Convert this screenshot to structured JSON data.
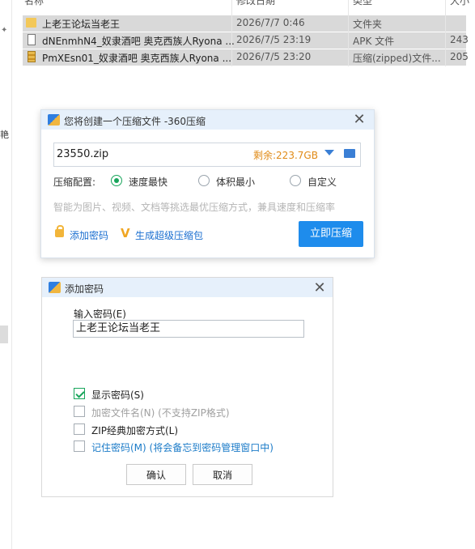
{
  "explorer": {
    "columns": [
      "名称",
      "修改日期",
      "类型",
      "大小"
    ],
    "files": [
      {
        "name": "上老王论坛当老王",
        "date": "2026/7/7 0:46",
        "type": "文件夹",
        "size": "",
        "icon": "folder-icon"
      },
      {
        "name": "dNEnmhN4_奴隶酒吧 奥克西族人Ryona ...",
        "date": "2026/7/5 23:19",
        "type": "APK 文件",
        "size": "243",
        "icon": "apk-file-icon"
      },
      {
        "name": "PmXEsn01_奴隶酒吧 奥克西族人Ryona ...",
        "date": "2026/7/5 23:20",
        "type": "压缩(zipped)文件...",
        "size": "205",
        "icon": "zip-file-icon"
      }
    ],
    "nav_fragment": "艳"
  },
  "compress_dialog": {
    "title": "您将创建一个压缩文件 -360压缩",
    "filename": "23550.zip",
    "free_space": "剩余:223.7GB",
    "config_label": "压缩配置:",
    "options": [
      {
        "label": "速度最快",
        "selected": true
      },
      {
        "label": "体积最小",
        "selected": false
      },
      {
        "label": "自定义",
        "selected": false
      }
    ],
    "hint": "智能为图片、视频、文档等挑选最优压缩方式，兼具速度和压缩率",
    "add_password": "添加密码",
    "super_package": "生成超级压缩包",
    "compress_now": "立即压缩"
  },
  "password_dialog": {
    "title": "添加密码",
    "input_label": "输入密码(E)",
    "password_value": "上老王论坛当老王",
    "checkboxes": [
      {
        "label": "显示密码(S)",
        "checked": true,
        "color": "#222222"
      },
      {
        "label": "加密文件名(N) (不支持ZIP格式)",
        "checked": false,
        "color": "#a0a0a0"
      },
      {
        "label": "ZIP经典加密方式(L)",
        "checked": false,
        "color": "#222222"
      },
      {
        "label": "记住密码(M) (将会备忘到密码管理窗口中)",
        "checked": false,
        "color": "#1b7bc8"
      }
    ],
    "ok": "确认",
    "cancel": "取消"
  },
  "colors": {
    "accent_blue": "#1e8cec",
    "free_space_orange": "#e08a16",
    "check_green": "#18a55b",
    "link_blue": "#1b6fd0"
  }
}
